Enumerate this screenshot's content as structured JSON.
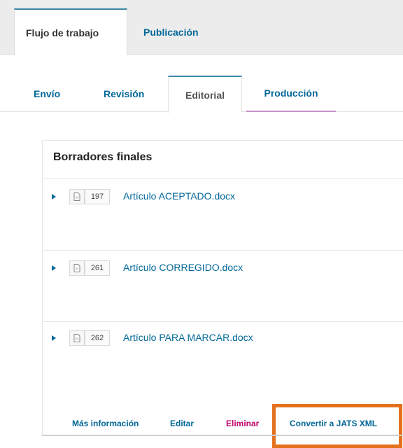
{
  "top_tabs": {
    "active": "Flujo de trabajo",
    "inactive": "Publicación"
  },
  "sub_tabs": [
    "Envío",
    "Revisión",
    "Editorial",
    "Producción"
  ],
  "panel": {
    "title": "Borradores finales",
    "files": [
      {
        "id": "197",
        "name": "Artículo ACEPTADO.docx"
      },
      {
        "id": "261",
        "name": "Artículo CORREGIDO.docx"
      },
      {
        "id": "262",
        "name": "Artículo PARA MARCAR.docx"
      }
    ],
    "actions": {
      "more_info": "Más información",
      "edit": "Editar",
      "delete": "Eliminar",
      "convert": "Convertir a JATS XML"
    }
  },
  "colors": {
    "link": "#006798",
    "danger": "#c3006d",
    "highlight": "#e5711c",
    "active_tab_border": "#3d87a8",
    "production_underline": "#c693c6"
  }
}
